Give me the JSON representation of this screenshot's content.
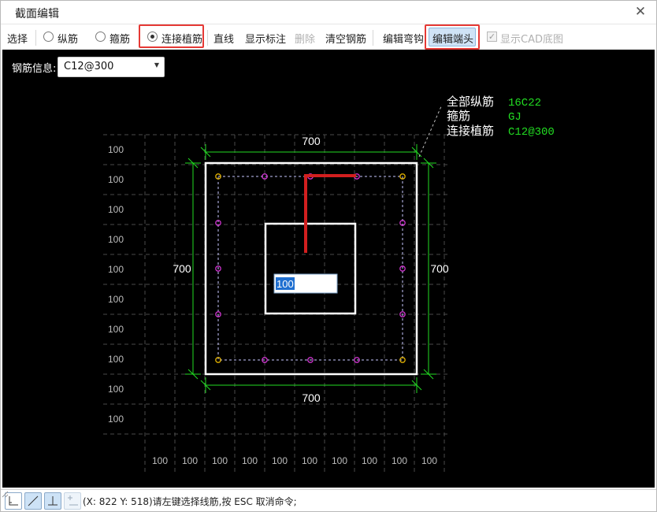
{
  "window": {
    "title": "截面编辑",
    "close_symbol": "✕"
  },
  "toolbar": {
    "select_label": "选择",
    "longitudinal_label": "纵筋",
    "stirrup_label": "箍筋",
    "connect_rebar_label": "连接植筋",
    "line_label": "直线",
    "show_annotation_label": "显示标注",
    "delete_label": "删除",
    "clear_rebar_label": "清空钢筋",
    "edit_hook_label": "编辑弯钩",
    "edit_end_label": "编辑端头",
    "show_cad_label": "显示CAD底图",
    "selected_radio": "connect_rebar",
    "show_cad_checked": true
  },
  "rebar_info": {
    "label": "钢筋信息:",
    "value": "C12@300"
  },
  "drawing": {
    "dim_top": "700",
    "dim_bottom": "700",
    "dim_left": "700",
    "dim_right": "700",
    "grid_row_labels": [
      "100",
      "100",
      "100",
      "100",
      "100",
      "100",
      "100",
      "100",
      "100",
      "100"
    ],
    "grid_col_labels": [
      "100",
      "100",
      "100",
      "100",
      "100",
      "100",
      "100",
      "100",
      "100",
      "100"
    ],
    "annotation": {
      "row1_label": "全部纵筋",
      "row1_value": "16C22",
      "row2_label": "箍筋",
      "row2_value": "GJ",
      "row3_label": "连接植筋",
      "row3_value": "C12@300"
    },
    "input_value": "100"
  },
  "statusbar": {
    "text": "(X: 822 Y: 518)请左键选择线筋,按 ESC 取消命令;",
    "icons": [
      "corner-ortho-icon",
      "diagonal-line-icon",
      "perpendicular-icon",
      "parallel-dim-icon"
    ]
  },
  "colors": {
    "canvas_bg": "#000000",
    "dimension": "#22dd22",
    "outline": "#ffffff",
    "rebar_point": "#cc33cc",
    "corner_rebar": "#e0b000",
    "connect_rebar": "#d21f1f",
    "annotation_value": "#22dd22",
    "highlight_box": "#e53935"
  }
}
